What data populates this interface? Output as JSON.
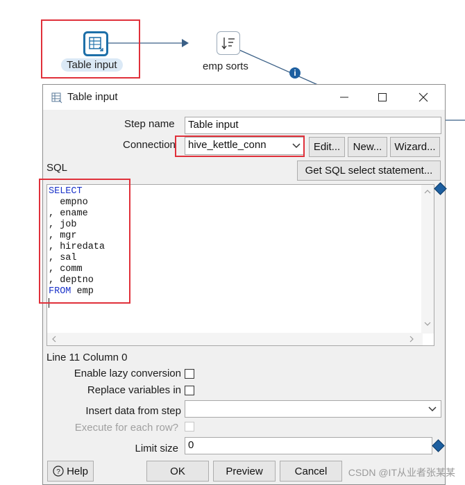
{
  "canvas": {
    "steps": [
      {
        "label": "Table input",
        "icon": "table-icon"
      },
      {
        "label": "emp sorts",
        "icon": "sort-icon"
      }
    ],
    "info_icon": "info-icon"
  },
  "dialog": {
    "title": "Table input",
    "window_controls": [
      "minimize-icon",
      "maximize-icon",
      "close-icon"
    ],
    "step_name_label": "Step name",
    "step_name_value": "Table input",
    "connection_label": "Connection",
    "connection_value": "hive_kettle_conn",
    "edit_label": "Edit...",
    "new_label": "New...",
    "wizard_label": "Wizard...",
    "sql_label": "SQL",
    "get_sql_label": "Get SQL select statement...",
    "sql_lines": [
      {
        "kw": "SELECT",
        "text": ""
      },
      {
        "kw": "",
        "text": "  empno"
      },
      {
        "kw": "",
        "text": ", ename"
      },
      {
        "kw": "",
        "text": ", job"
      },
      {
        "kw": "",
        "text": ", mgr"
      },
      {
        "kw": "",
        "text": ", hiredata"
      },
      {
        "kw": "",
        "text": ", sal"
      },
      {
        "kw": "",
        "text": ", comm"
      },
      {
        "kw": "",
        "text": ", deptno"
      },
      {
        "kw": "FROM",
        "text": " emp"
      }
    ],
    "cursor_position": "Line 11 Column 0",
    "lazy_conversion_label": "Enable lazy conversion",
    "replace_variables_label": "Replace variables in",
    "insert_data_label": "Insert data from step",
    "insert_data_value": "",
    "execute_each_row_label": "Execute for each row?",
    "limit_size_label": "Limit size",
    "limit_size_value": "0",
    "help_label": "Help",
    "ok_label": "OK",
    "preview_label": "Preview",
    "cancel_label": "Cancel"
  },
  "watermark": "CSDN @IT从业者张某某",
  "colors": {
    "accent": "#1d6fa8",
    "highlight_box": "#e0303a",
    "sql_keyword": "#1b33c9"
  }
}
